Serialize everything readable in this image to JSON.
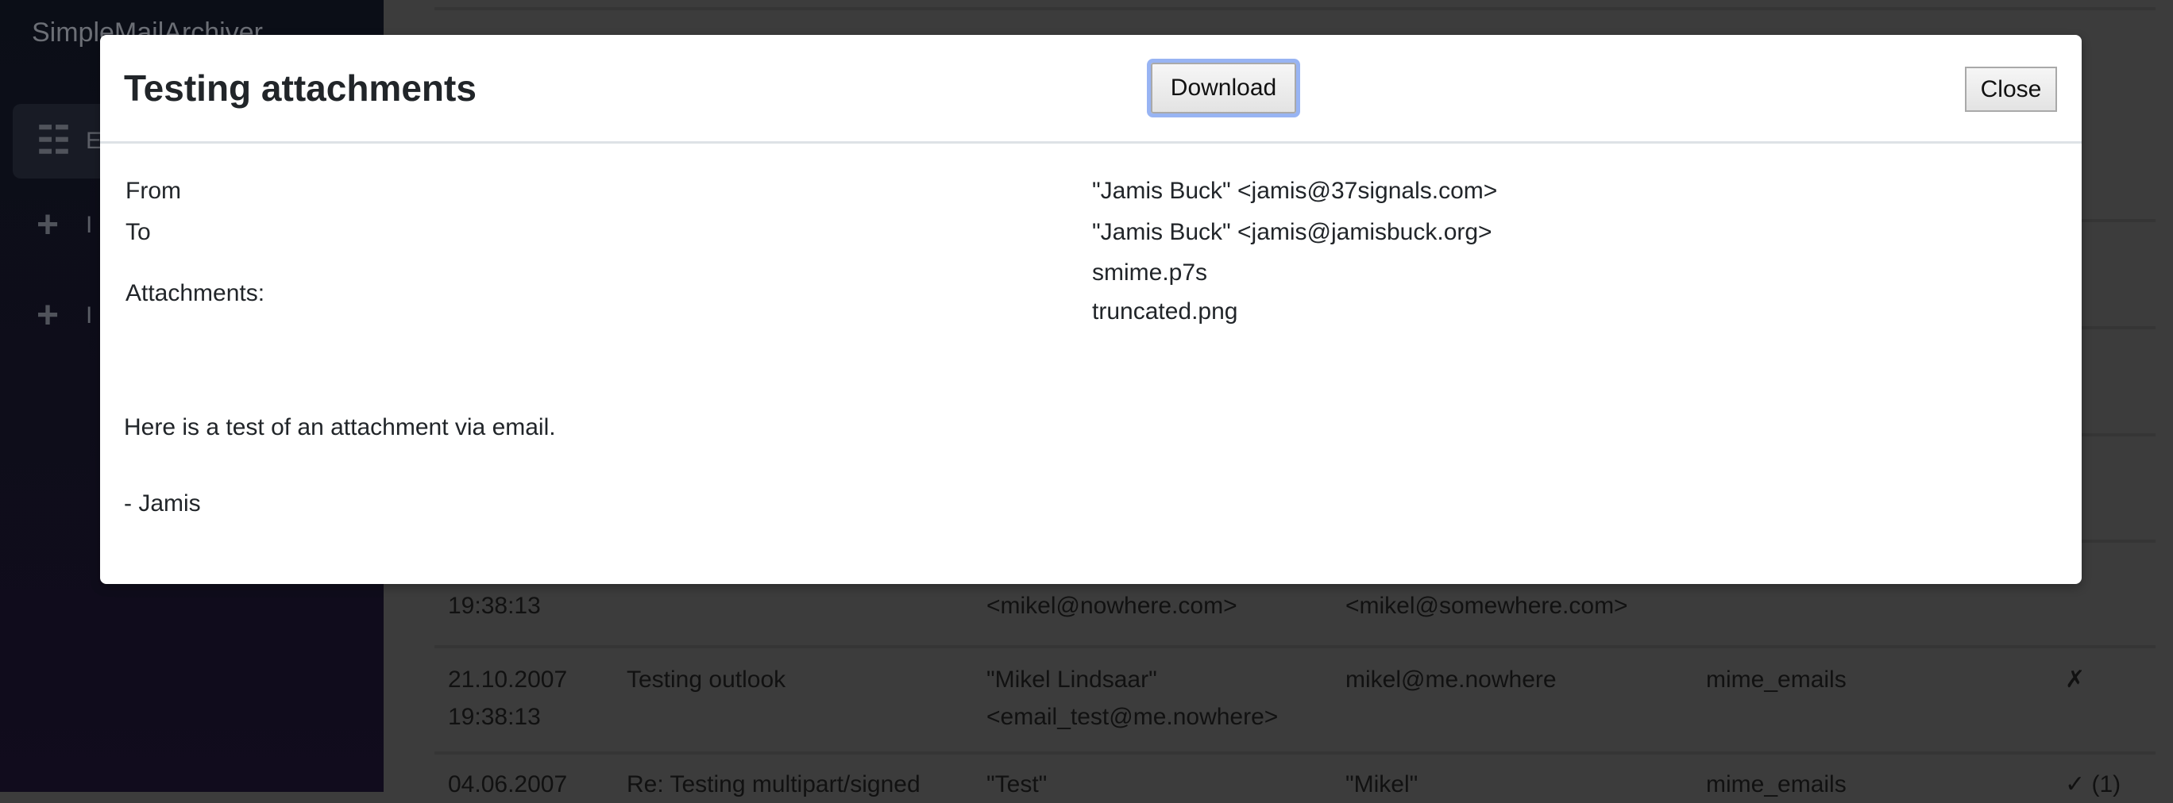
{
  "app": {
    "brand": "SimpleMailArchiver"
  },
  "sidebar": {
    "items": [
      {
        "label": "E",
        "icon": "list-icon"
      },
      {
        "label": "I",
        "icon": "plus-icon"
      },
      {
        "label": "I",
        "icon": "plus-icon"
      }
    ]
  },
  "table": {
    "rows": [
      {
        "date": "",
        "time": "19:38:13",
        "subject": "",
        "from": "<mikel@nowhere.com>",
        "to": "<mikel@somewhere.com>",
        "folder": "",
        "attachments": ""
      },
      {
        "date": "21.10.2007",
        "time": "19:38:13",
        "subject": "Testing outlook",
        "from": "\"Mikel Lindsaar\"",
        "from2": "<email_test@me.nowhere>",
        "to": "mikel@me.nowhere",
        "folder": "mime_emails",
        "attachments": "✗"
      },
      {
        "date": "04.06.2007",
        "subject": "Re: Testing multipart/signed",
        "from": "\"Test\"",
        "to": "\"Mikel\"",
        "folder": "mime_emails",
        "attachments": "✓ (1)"
      }
    ]
  },
  "modal": {
    "title": "Testing attachments",
    "download_label": "Download",
    "close_label": "Close",
    "from_label": "From",
    "from_value": "\"Jamis Buck\" <jamis@37signals.com>",
    "to_label": "To",
    "to_value": "\"Jamis Buck\" <jamis@jamisbuck.org>",
    "attachments_label": "Attachments:",
    "attachments": [
      "smime.p7s",
      "truncated.png"
    ],
    "body": [
      "Here is a test of an attachment via email.",
      "- Jamis"
    ]
  }
}
